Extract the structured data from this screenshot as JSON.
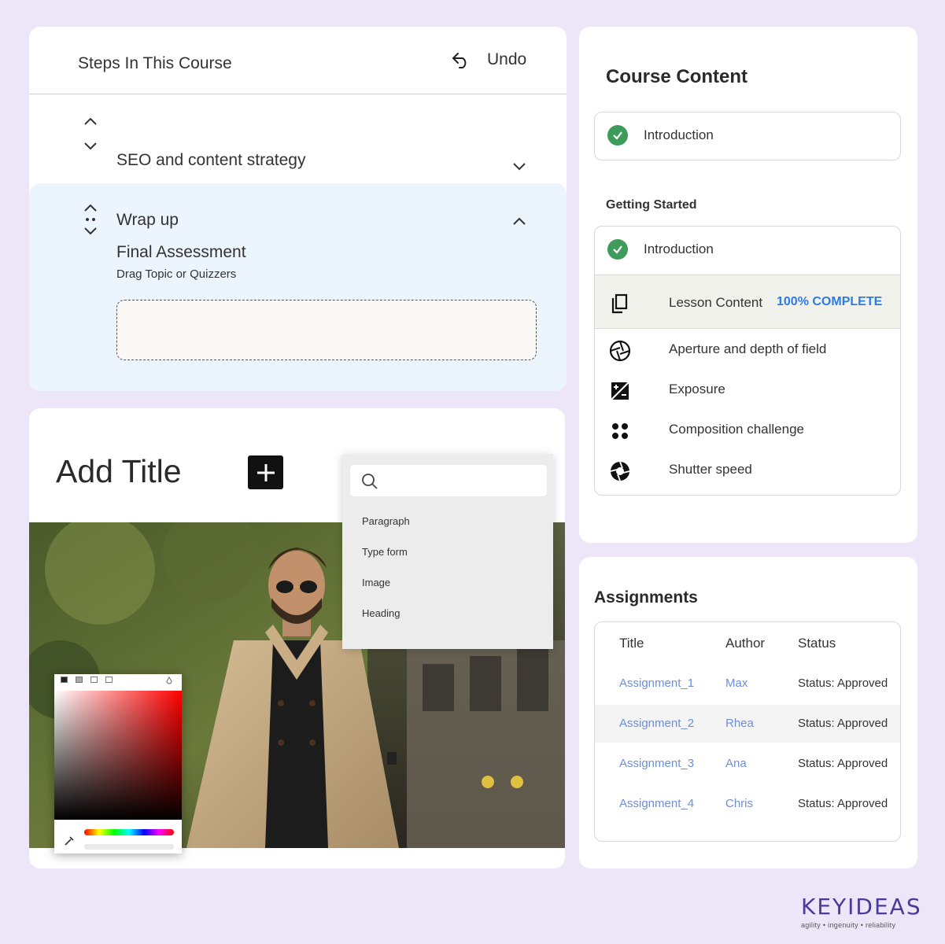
{
  "steps": {
    "header": "Steps In This Course",
    "undo_label": "Undo",
    "items": [
      {
        "name": "SEO and content strategy"
      },
      {
        "name": "Wrap  up",
        "sub_title": "Final Assessment",
        "hint": "Drag Topic or Quizzers"
      }
    ]
  },
  "editor": {
    "title": "Add Title",
    "search_placeholder": "",
    "menu_items": [
      "Paragraph",
      "Type form",
      "Image",
      "Heading"
    ]
  },
  "course_content": {
    "title": "Course Content",
    "intro_label": "Introduction",
    "section_title": "Getting Started",
    "section_intro": "Introduction",
    "lesson_label": "Lesson Content",
    "lesson_progress": "100% COMPLETE",
    "items": [
      {
        "label": "Aperture and depth of field",
        "icon": "aperture-icon"
      },
      {
        "label": "Exposure",
        "icon": "exposure-icon"
      },
      {
        "label": "Composition challenge",
        "icon": "dots-grid-icon"
      },
      {
        "label": "Shutter speed",
        "icon": "shutter-icon"
      }
    ]
  },
  "assignments": {
    "title": "Assignments",
    "columns": [
      "Title",
      "Author",
      "Status"
    ],
    "rows": [
      {
        "title": "Assignment_1",
        "author": "Max",
        "status": "Status: Approved"
      },
      {
        "title": "Assignment_2",
        "author": "Rhea",
        "status": "Status: Approved"
      },
      {
        "title": "Assignment_3",
        "author": "Ana",
        "status": "Status: Approved"
      },
      {
        "title": "Assignment_4",
        "author": "Chris",
        "status": "Status: Approved"
      }
    ]
  },
  "brand": {
    "name": "KEYIDEAS",
    "tagline": "agility  •  ingenuity  •  reliability"
  },
  "colors": {
    "background": "#ede6f9",
    "highlight_row": "#ecf4fd",
    "progress": "#2d7be6",
    "success": "#3f9b5c",
    "link": "#6d8fd9",
    "brand": "#4a3a9a"
  }
}
